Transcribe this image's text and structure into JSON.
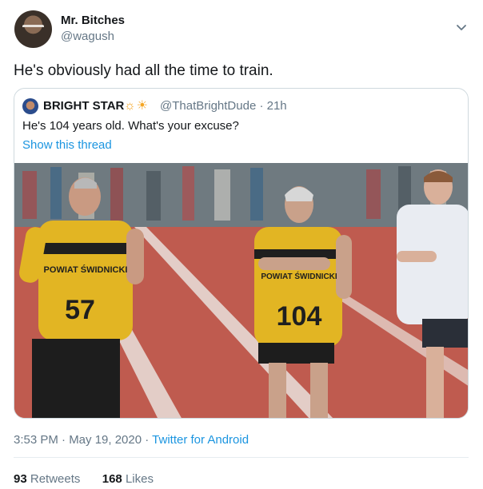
{
  "tweet": {
    "display_name": "Mr. Bitches",
    "handle": "@wagush",
    "text": "He's obviously had all the time to train.",
    "timestamp": "3:53 PM · May 19, 2020",
    "separator": " · ",
    "source": "Twitter for Android",
    "retweets_count": "93",
    "retweets_label": "Retweets",
    "likes_count": "168",
    "likes_label": "Likes"
  },
  "quoted": {
    "display_name": "BRIGHT STAR",
    "emoji": "☼☀",
    "handle_time": "@ThatBrightDude · 21h",
    "text": "He's 104 years old. What's your excuse?",
    "show_thread": "Show this thread",
    "photo": {
      "runner_left_bib": "57",
      "runner_left_shirt": "POWIAT ŚWIDNICKI",
      "runner_center_bib": "104",
      "runner_center_shirt": "POWIAT ŚWIDNICKI"
    }
  },
  "icons": {
    "more": "chevron-down-icon"
  }
}
